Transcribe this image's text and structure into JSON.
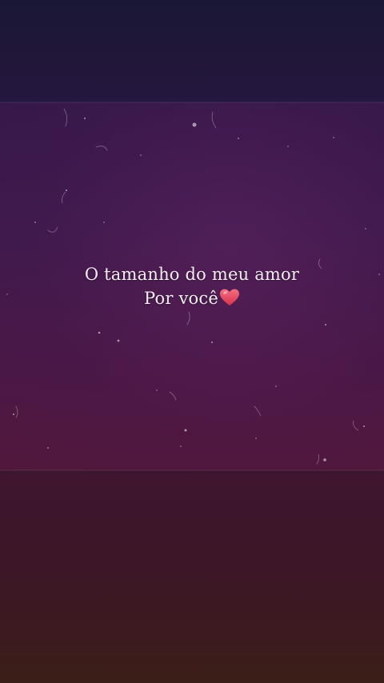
{
  "caption": {
    "line1": "O tamanho do meu amor",
    "line2": "Por você"
  },
  "icons": {
    "heart": "heart-icon"
  },
  "colors": {
    "heart": "#e8475f",
    "text": "#f4eef2"
  }
}
